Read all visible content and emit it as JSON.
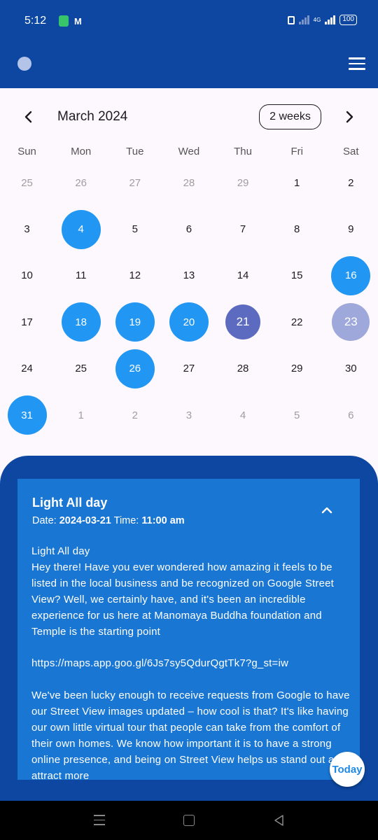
{
  "status_bar": {
    "time": "5:12",
    "mail_glyph": "M",
    "net_label": "4G",
    "battery": "100"
  },
  "header": {
    "month_title": "March 2024",
    "format_button": "2 weeks"
  },
  "weekdays": [
    "Sun",
    "Mon",
    "Tue",
    "Wed",
    "Thu",
    "Fri",
    "Sat"
  ],
  "weeks": [
    [
      {
        "label": "25",
        "state": "out"
      },
      {
        "label": "26",
        "state": "out"
      },
      {
        "label": "27",
        "state": "out"
      },
      {
        "label": "28",
        "state": "out"
      },
      {
        "label": "29",
        "state": "out"
      },
      {
        "label": "1",
        "state": "normal"
      },
      {
        "label": "2",
        "state": "normal"
      }
    ],
    [
      {
        "label": "3",
        "state": "normal"
      },
      {
        "label": "4",
        "state": "event"
      },
      {
        "label": "5",
        "state": "normal"
      },
      {
        "label": "6",
        "state": "normal"
      },
      {
        "label": "7",
        "state": "normal"
      },
      {
        "label": "8",
        "state": "normal"
      },
      {
        "label": "9",
        "state": "normal"
      }
    ],
    [
      {
        "label": "10",
        "state": "normal"
      },
      {
        "label": "11",
        "state": "normal"
      },
      {
        "label": "12",
        "state": "normal"
      },
      {
        "label": "13",
        "state": "normal"
      },
      {
        "label": "14",
        "state": "normal"
      },
      {
        "label": "15",
        "state": "normal"
      },
      {
        "label": "16",
        "state": "event"
      }
    ],
    [
      {
        "label": "17",
        "state": "normal"
      },
      {
        "label": "18",
        "state": "event"
      },
      {
        "label": "19",
        "state": "event"
      },
      {
        "label": "20",
        "state": "event"
      },
      {
        "label": "21",
        "state": "today"
      },
      {
        "label": "22",
        "state": "normal"
      },
      {
        "label": "23",
        "state": "light"
      }
    ],
    [
      {
        "label": "24",
        "state": "normal"
      },
      {
        "label": "25",
        "state": "normal"
      },
      {
        "label": "26",
        "state": "event"
      },
      {
        "label": "27",
        "state": "normal"
      },
      {
        "label": "28",
        "state": "normal"
      },
      {
        "label": "29",
        "state": "normal"
      },
      {
        "label": "30",
        "state": "normal"
      }
    ],
    [
      {
        "label": "31",
        "state": "event"
      },
      {
        "label": "1",
        "state": "out"
      },
      {
        "label": "2",
        "state": "out"
      },
      {
        "label": "3",
        "state": "out"
      },
      {
        "label": "4",
        "state": "out"
      },
      {
        "label": "5",
        "state": "out"
      },
      {
        "label": "6",
        "state": "out"
      }
    ]
  ],
  "event": {
    "title": "Light All day",
    "date_label": "Date: ",
    "date_value": "2024-03-21",
    "time_label": " Time: ",
    "time_value": "11:00 am",
    "description": "Light All day\nHey there! Have you ever wondered how amazing it feels to be listed in the local business and be recognized on Google Street View? Well, we certainly have, and it's been an incredible experience for us here at Manomaya Buddha foundation and Temple is the starting point\n\nhttps://maps.app.goo.gl/6Js7sy5QdurQgtTk7?g_st=iw\n\nWe've been lucky enough to receive requests from Google to have our Street View images updated – how cool is that? It's like having our own little virtual tour that people can take from the comfort of their own homes. We know how important it is to have a strong online presence, and being on Street View helps us stand out and attract more"
  },
  "today_button": "Today",
  "colors": {
    "app_bar": "#0d47a1",
    "event_day": "#2196f3",
    "today_day": "#5c6bc0",
    "light_day": "#9fa8da",
    "card": "#1976d2"
  },
  "icons": {
    "prev": "chevron-left-icon",
    "next": "chevron-right-icon",
    "menu": "hamburger-menu-icon",
    "collapse": "chevron-up-icon"
  }
}
